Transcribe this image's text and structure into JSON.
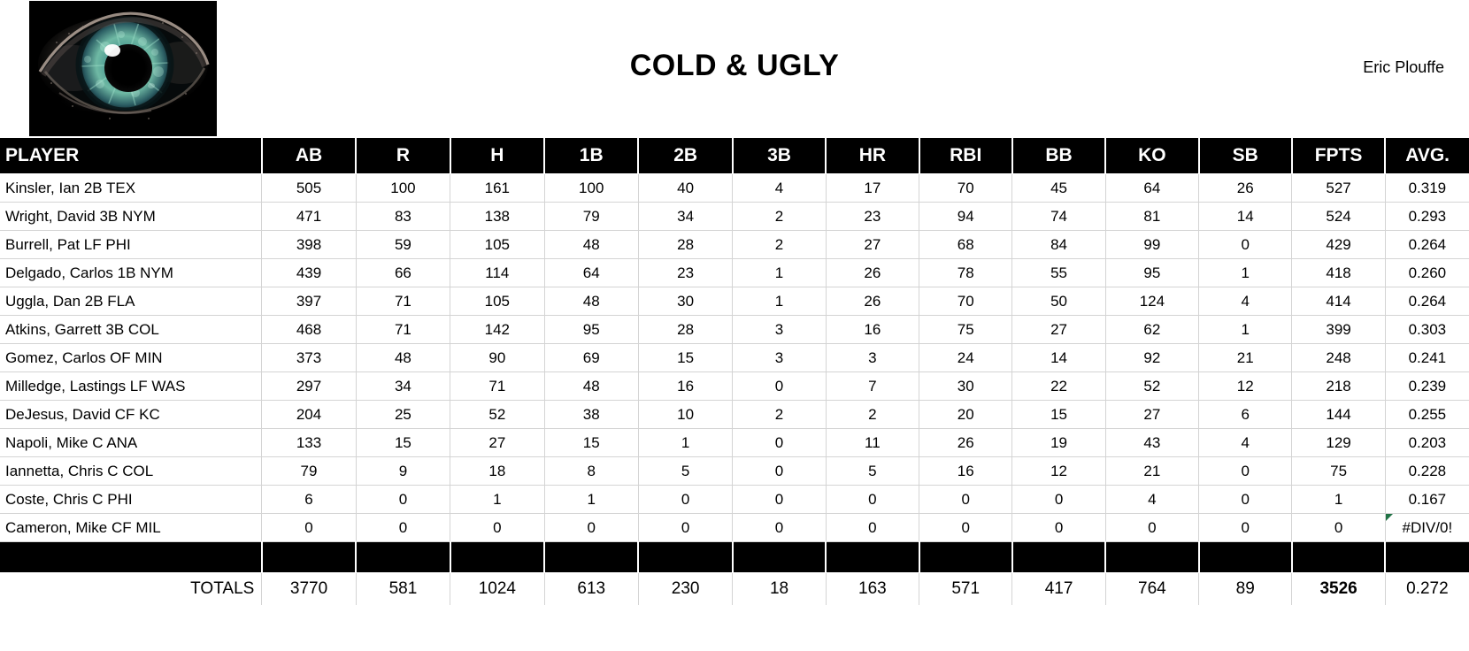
{
  "header": {
    "title": "COLD & UGLY",
    "author": "Eric Plouffe",
    "logo_icon": "eye-image"
  },
  "table": {
    "columns": [
      "PLAYER",
      "AB",
      "R",
      "H",
      "1B",
      "2B",
      "3B",
      "HR",
      "RBI",
      "BB",
      "KO",
      "SB",
      "FPTS",
      "AVG."
    ],
    "rows": [
      {
        "player": "Kinsler, Ian 2B TEX",
        "ab": "505",
        "r": "100",
        "h": "161",
        "b1": "100",
        "b2": "40",
        "b3": "4",
        "hr": "17",
        "rbi": "70",
        "bb": "45",
        "ko": "64",
        "sb": "26",
        "fpts": "527",
        "avg": "0.319"
      },
      {
        "player": "Wright, David 3B NYM",
        "ab": "471",
        "r": "83",
        "h": "138",
        "b1": "79",
        "b2": "34",
        "b3": "2",
        "hr": "23",
        "rbi": "94",
        "bb": "74",
        "ko": "81",
        "sb": "14",
        "fpts": "524",
        "avg": "0.293"
      },
      {
        "player": "Burrell, Pat LF PHI",
        "ab": "398",
        "r": "59",
        "h": "105",
        "b1": "48",
        "b2": "28",
        "b3": "2",
        "hr": "27",
        "rbi": "68",
        "bb": "84",
        "ko": "99",
        "sb": "0",
        "fpts": "429",
        "avg": "0.264"
      },
      {
        "player": "Delgado, Carlos 1B NYM",
        "ab": "439",
        "r": "66",
        "h": "114",
        "b1": "64",
        "b2": "23",
        "b3": "1",
        "hr": "26",
        "rbi": "78",
        "bb": "55",
        "ko": "95",
        "sb": "1",
        "fpts": "418",
        "avg": "0.260"
      },
      {
        "player": "Uggla, Dan 2B FLA",
        "ab": "397",
        "r": "71",
        "h": "105",
        "b1": "48",
        "b2": "30",
        "b3": "1",
        "hr": "26",
        "rbi": "70",
        "bb": "50",
        "ko": "124",
        "sb": "4",
        "fpts": "414",
        "avg": "0.264"
      },
      {
        "player": "Atkins, Garrett 3B COL",
        "ab": "468",
        "r": "71",
        "h": "142",
        "b1": "95",
        "b2": "28",
        "b3": "3",
        "hr": "16",
        "rbi": "75",
        "bb": "27",
        "ko": "62",
        "sb": "1",
        "fpts": "399",
        "avg": "0.303"
      },
      {
        "player": "Gomez, Carlos OF MIN",
        "ab": "373",
        "r": "48",
        "h": "90",
        "b1": "69",
        "b2": "15",
        "b3": "3",
        "hr": "3",
        "rbi": "24",
        "bb": "14",
        "ko": "92",
        "sb": "21",
        "fpts": "248",
        "avg": "0.241"
      },
      {
        "player": "Milledge, Lastings LF WAS",
        "ab": "297",
        "r": "34",
        "h": "71",
        "b1": "48",
        "b2": "16",
        "b3": "0",
        "hr": "7",
        "rbi": "30",
        "bb": "22",
        "ko": "52",
        "sb": "12",
        "fpts": "218",
        "avg": "0.239"
      },
      {
        "player": "DeJesus, David CF KC",
        "ab": "204",
        "r": "25",
        "h": "52",
        "b1": "38",
        "b2": "10",
        "b3": "2",
        "hr": "2",
        "rbi": "20",
        "bb": "15",
        "ko": "27",
        "sb": "6",
        "fpts": "144",
        "avg": "0.255"
      },
      {
        "player": "Napoli, Mike C ANA",
        "ab": "133",
        "r": "15",
        "h": "27",
        "b1": "15",
        "b2": "1",
        "b3": "0",
        "hr": "11",
        "rbi": "26",
        "bb": "19",
        "ko": "43",
        "sb": "4",
        "fpts": "129",
        "avg": "0.203"
      },
      {
        "player": "Iannetta, Chris C COL",
        "ab": "79",
        "r": "9",
        "h": "18",
        "b1": "8",
        "b2": "5",
        "b3": "0",
        "hr": "5",
        "rbi": "16",
        "bb": "12",
        "ko": "21",
        "sb": "0",
        "fpts": "75",
        "avg": "0.228"
      },
      {
        "player": "Coste, Chris C PHI",
        "ab": "6",
        "r": "0",
        "h": "1",
        "b1": "1",
        "b2": "0",
        "b3": "0",
        "hr": "0",
        "rbi": "0",
        "bb": "0",
        "ko": "4",
        "sb": "0",
        "fpts": "1",
        "avg": "0.167"
      },
      {
        "player": "Cameron, Mike CF MIL",
        "ab": "0",
        "r": "0",
        "h": "0",
        "b1": "0",
        "b2": "0",
        "b3": "0",
        "hr": "0",
        "rbi": "0",
        "bb": "0",
        "ko": "0",
        "sb": "0",
        "fpts": "0",
        "avg": "#DIV/0!"
      }
    ],
    "totals": {
      "label": "TOTALS",
      "ab": "3770",
      "r": "581",
      "h": "1024",
      "b1": "613",
      "b2": "230",
      "b3": "18",
      "hr": "163",
      "rbi": "571",
      "bb": "417",
      "ko": "764",
      "sb": "89",
      "fpts": "3526",
      "avg": "0.272"
    }
  },
  "colors": {
    "header_bg": "#000000",
    "header_text": "#ffffff",
    "grid": "#d4d4d4",
    "error_flag": "#217346",
    "page_bg": "#ffffff"
  }
}
